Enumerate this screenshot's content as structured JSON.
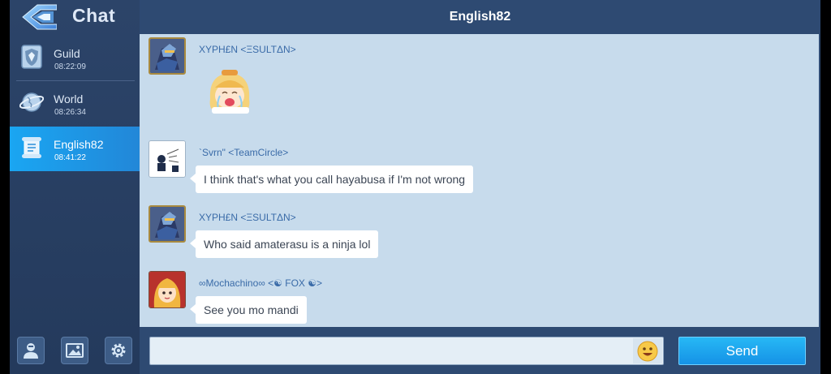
{
  "header": {
    "back_title": "Chat",
    "channel_title": "English82"
  },
  "sidebar": {
    "channels": [
      {
        "name": "Guild",
        "time": "08:22:09",
        "icon": "guild-shield-icon",
        "active": false
      },
      {
        "name": "World",
        "time": "08:26:34",
        "icon": "world-globe-icon",
        "active": false
      },
      {
        "name": "English82",
        "time": "08:41:22",
        "icon": "scroll-icon",
        "active": true
      }
    ],
    "bottom_buttons": [
      "friends-icon",
      "image-icon",
      "gear-icon"
    ]
  },
  "messages": [
    {
      "sender": "XYPH£N <ΞSULTΔN>",
      "text": "",
      "type": "sticker",
      "sticker": "crying-girl-sticker"
    },
    {
      "sender": "`Svrn\" <TeamCircle>",
      "text": "I think that's what you call hayabusa if I'm not wrong",
      "type": "text"
    },
    {
      "sender": "XYPH£N <ΞSULTΔN>",
      "text": "Who said amaterasu is a ninja lol",
      "type": "text"
    },
    {
      "sender": "∞Mochachino∞ <☯ FOX ☯>",
      "text": "See you mo mandi",
      "type": "text"
    }
  ],
  "input": {
    "value": "",
    "placeholder": ""
  },
  "send_label": "Send",
  "colors": {
    "background": "#2e4a72",
    "panel": "#c7dbec",
    "active_channel": "#1aa6f2",
    "send_button": "#1c9ee9",
    "sender_name": "#3a6ba8"
  }
}
